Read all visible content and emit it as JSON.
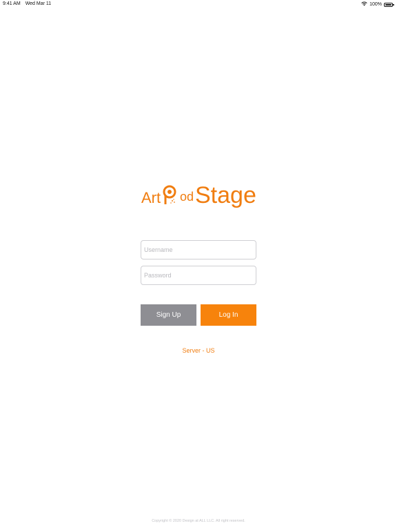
{
  "status_bar": {
    "time": "9:41 AM",
    "date": "Wed Mar 11",
    "battery_percent": "100%",
    "wifi_icon": "wifi-icon",
    "battery_icon": "battery-icon",
    "battery_level": 1.0
  },
  "logo": {
    "part_art": "Art",
    "part_od": "od",
    "part_stage": "Stage",
    "mark_icon": "pod-logo-icon",
    "color": "#f07d10"
  },
  "form": {
    "username_placeholder": "Username",
    "username_value": "",
    "password_placeholder": "Password",
    "password_value": ""
  },
  "buttons": {
    "signup_label": "Sign Up",
    "signup_color": "#8e8e93",
    "login_label": "Log In",
    "login_color": "#f7830c"
  },
  "server": {
    "label": "Server - US"
  },
  "footer": {
    "copyright": "Copyright © 2020 Design at ALL LLC. All right reserved."
  }
}
